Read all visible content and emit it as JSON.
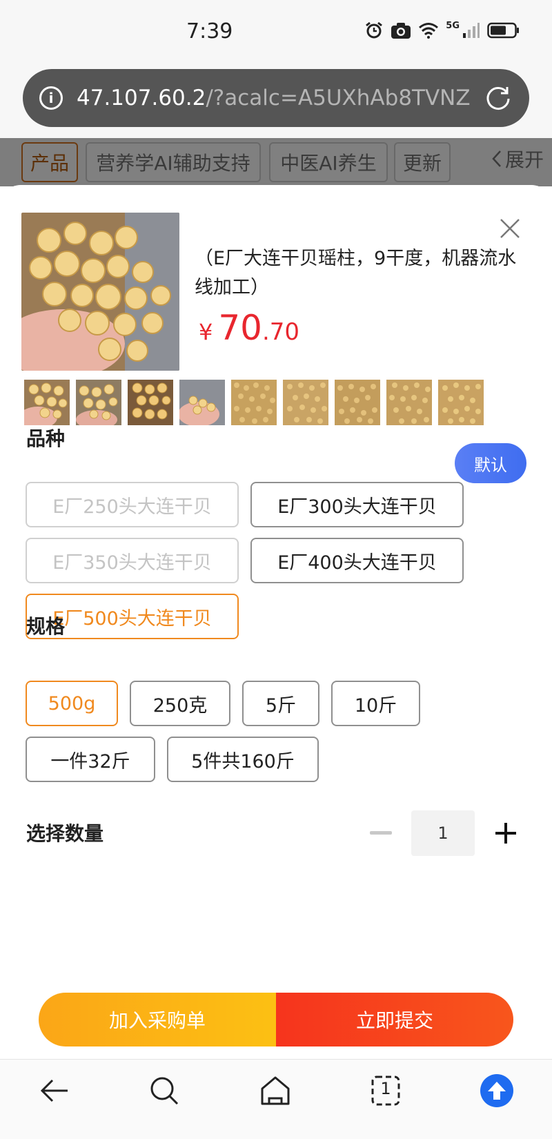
{
  "status_bar": {
    "time": "7:39",
    "network": "5G"
  },
  "browser": {
    "url_host": "47.107.60.2",
    "url_path": "/?acalc=A5UXhAb8TVNZ#"
  },
  "nav": {
    "tabs": [
      "产品",
      "营养学AI辅助支持",
      "中医AI养生",
      "更新"
    ],
    "expand_label": "展开"
  },
  "product": {
    "title": "（E厂大连干贝瑶柱，9干度，机器流水线加工）",
    "price_currency": "¥",
    "price_int": "70",
    "price_dec": ".70",
    "thumbnail_count": 9
  },
  "variety": {
    "label": "品种",
    "default_badge": "默认",
    "options": [
      {
        "label": "E厂250头大连干贝",
        "state": "disabled"
      },
      {
        "label": "E厂300头大连干贝",
        "state": "normal"
      },
      {
        "label": "E厂350头大连干贝",
        "state": "disabled"
      },
      {
        "label": "E厂400头大连干贝",
        "state": "normal"
      },
      {
        "label": "E厂500头大连干贝",
        "state": "selected"
      }
    ]
  },
  "spec": {
    "label": "规格",
    "options": [
      {
        "label": "500g",
        "state": "selected"
      },
      {
        "label": "250克",
        "state": "normal"
      },
      {
        "label": "5斤",
        "state": "normal"
      },
      {
        "label": "10斤",
        "state": "normal"
      },
      {
        "label": "一件32斤",
        "state": "normal"
      },
      {
        "label": "5件共160斤",
        "state": "normal"
      }
    ]
  },
  "quantity": {
    "label": "选择数量",
    "value": "1"
  },
  "actions": {
    "add_to_cart": "加入采购单",
    "submit": "立即提交"
  },
  "bottom_nav": {
    "tab_count": "1"
  },
  "colors": {
    "accent": "#f0891e",
    "price": "#e8262e",
    "badge": "#4a74f2",
    "submit": "#f6341d",
    "cart": "#fcb315"
  },
  "icons": [
    "alarm-icon",
    "camera-icon",
    "wifi-icon",
    "signal-icon",
    "battery-icon",
    "info-icon",
    "reload-icon",
    "close-icon",
    "back-icon",
    "search-icon",
    "home-icon",
    "tabs-icon",
    "scroll-top-icon"
  ]
}
